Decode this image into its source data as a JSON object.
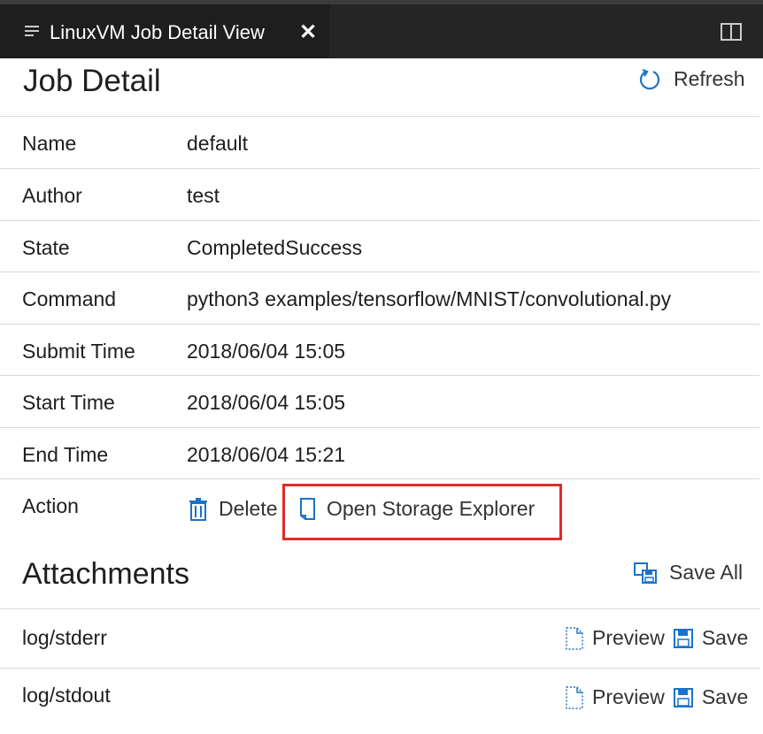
{
  "tab": {
    "title": "LinuxVM Job Detail View",
    "close_glyph": "✕"
  },
  "header": {
    "title": "Job Detail",
    "refresh_label": "Refresh"
  },
  "details": [
    {
      "label": "Name",
      "value": "default"
    },
    {
      "label": "Author",
      "value": "test"
    },
    {
      "label": "State",
      "value": "CompletedSuccess"
    },
    {
      "label": "Command",
      "value": "python3 examples/tensorflow/MNIST/convolutional.py"
    },
    {
      "label": "Submit Time",
      "value": "2018/06/04 15:05"
    },
    {
      "label": "Start Time",
      "value": "2018/06/04 15:05"
    },
    {
      "label": "End Time",
      "value": "2018/06/04 15:21"
    }
  ],
  "action": {
    "label": "Action",
    "delete_label": "Delete",
    "open_storage_label": "Open Storage Explorer"
  },
  "attachments": {
    "title": "Attachments",
    "save_all_label": "Save All",
    "items": [
      {
        "name": "log/stderr",
        "preview_label": "Preview",
        "save_label": "Save"
      },
      {
        "name": "log/stdout",
        "preview_label": "Preview",
        "save_label": "Save"
      }
    ]
  },
  "colors": {
    "accent": "#1a73c8",
    "highlight": "#e02b2b",
    "tab_bg": "#1e1e1e"
  }
}
